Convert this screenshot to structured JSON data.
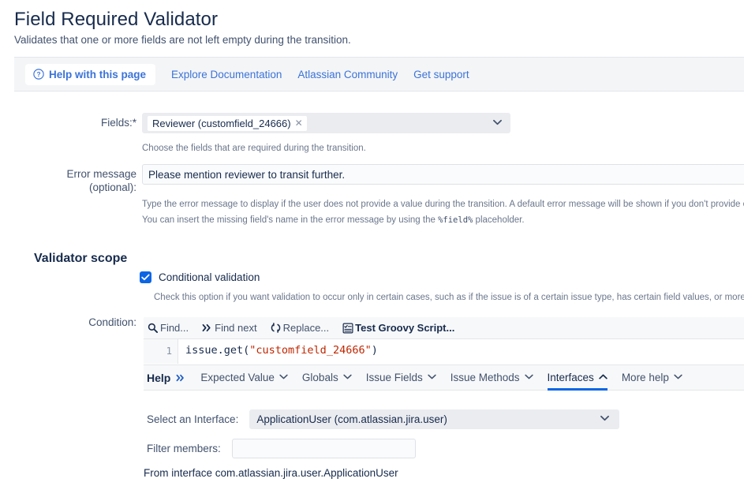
{
  "header": {
    "title": "Field Required Validator",
    "subtitle": "Validates that one or more fields are not left empty during the transition."
  },
  "help_bar": {
    "help_button": "Help with this page",
    "help_icon": "question-circle-icon",
    "links": [
      "Explore Documentation",
      "Atlassian Community",
      "Get support"
    ]
  },
  "form": {
    "fields": {
      "label": "Fields:*",
      "chip_value": "Reviewer (customfield_24666)",
      "chip_remove_icon": "close-icon",
      "caret_icon": "chevron-down-icon",
      "hint": "Choose the fields that are required during the transition."
    },
    "error_message": {
      "label_line1": "Error message",
      "label_line2": "(optional):",
      "value": "Please mention reviewer to transit further.",
      "placeholder": "",
      "hint1": "Type the error message to display if the user does not provide a value during the transition. A default error message will be shown if you don't provide one.",
      "hint2_prefix": "You can insert the missing field's name in the error message by using the ",
      "hint2_token": "%field%",
      "hint2_suffix": " placeholder."
    }
  },
  "validator_scope": {
    "section_title": "Validator scope",
    "checkbox_label": "Conditional validation",
    "checkbox_checked": true,
    "check_icon": "checkmark-icon",
    "accent_color": "#0c66e4",
    "hint": "Check this option if you want validation to occur only in certain cases, such as if the issue is of a certain issue type, has certain field values, or more generally satisfies"
  },
  "condition": {
    "label": "Condition:",
    "toolbar": [
      {
        "label": "Find...",
        "icon": "search-icon",
        "bold": false
      },
      {
        "label": "Find next",
        "icon": "chevron-double-right-icon",
        "bold": false
      },
      {
        "label": "Replace...",
        "icon": "refresh-icon",
        "bold": false
      },
      {
        "label": "Test Groovy Script...",
        "icon": "script-test-icon",
        "bold": true
      }
    ],
    "code": {
      "line_number": "1",
      "prefix": "issue.get(",
      "string": "\"customfield_24666\"",
      "suffix": ")"
    },
    "help_tabs": {
      "lead_label": "Help",
      "lead_icon": "chevron-double-right-icon",
      "tabs": [
        {
          "label": "Expected Value",
          "icon": "chevron-down-icon",
          "active": false
        },
        {
          "label": "Globals",
          "icon": "chevron-down-icon",
          "active": false
        },
        {
          "label": "Issue Fields",
          "icon": "chevron-down-icon",
          "active": false
        },
        {
          "label": "Issue Methods",
          "icon": "chevron-down-icon",
          "active": false
        },
        {
          "label": "Interfaces",
          "icon": "chevron-up-icon",
          "active": true
        },
        {
          "label": "More help",
          "icon": "chevron-down-icon",
          "active": false
        }
      ]
    },
    "interfaces_panel": {
      "select_label": "Select an Interface:",
      "select_value": "ApplicationUser (com.atlassian.jira.user)",
      "select_caret_icon": "chevron-down-icon",
      "filter_label": "Filter members:",
      "filter_value": "",
      "filter_placeholder": "",
      "from_interface": "From interface com.atlassian.jira.user.ApplicationUser"
    }
  }
}
